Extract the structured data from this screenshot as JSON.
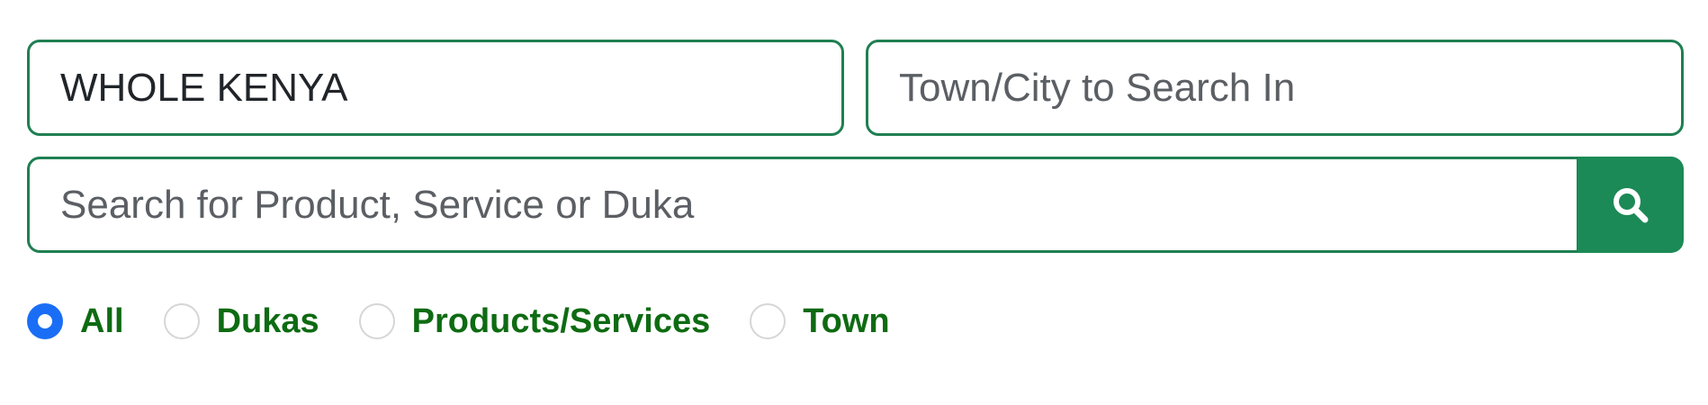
{
  "location": {
    "value": "WHOLE KENYA"
  },
  "town": {
    "placeholder": "Town/City to Search In",
    "value": ""
  },
  "search": {
    "placeholder": "Search for Product, Service or Duka",
    "value": "",
    "button_icon": "search-icon"
  },
  "filter": {
    "selected": "All",
    "options": [
      {
        "label": "All",
        "checked": true
      },
      {
        "label": "Dukas",
        "checked": false
      },
      {
        "label": "Products/Services",
        "checked": false
      },
      {
        "label": "Town",
        "checked": false
      }
    ]
  },
  "colors": {
    "border": "#1f7f52",
    "button": "#1b8a56",
    "radio_label": "#0e6b12",
    "radio_checked": "#1a6ef5"
  }
}
